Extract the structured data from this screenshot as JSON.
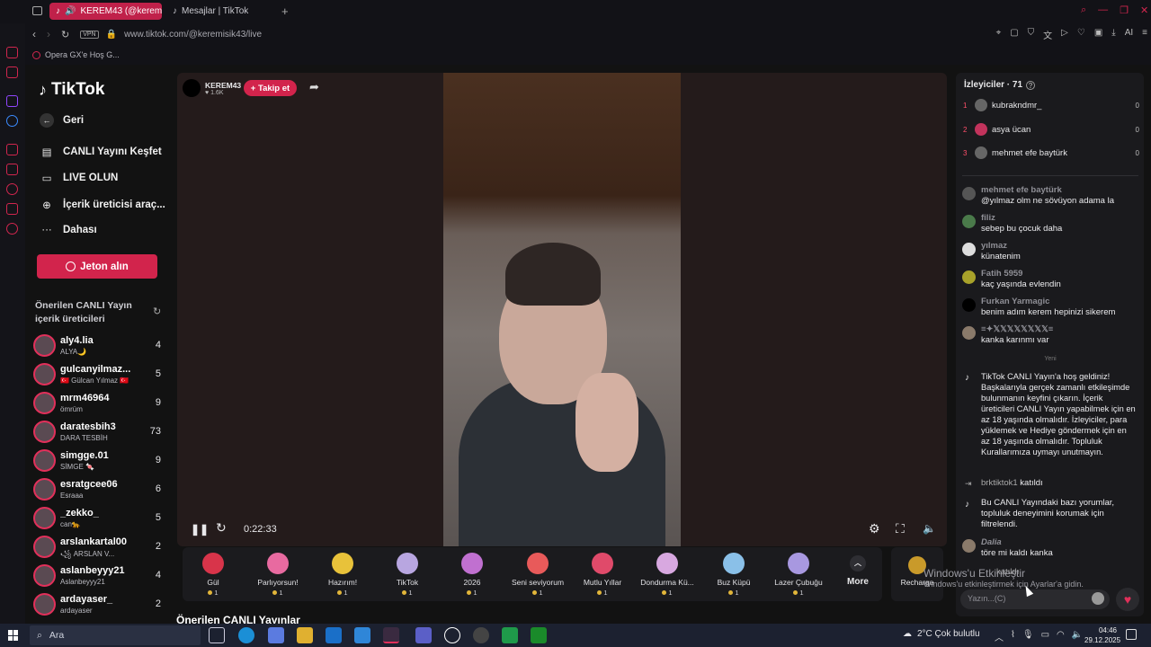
{
  "browser": {
    "tabs": [
      {
        "label": "KEREM43 (@keremsik"
      },
      {
        "label": "Mesajlar | TikTok"
      }
    ],
    "vpn": "VPN",
    "url": "www.tiktok.com/@keremisik43/live",
    "ai": "AI",
    "bookmark": "Opera GX'e Hoş G..."
  },
  "sidebar": {
    "logo": "TikTok",
    "nav": [
      {
        "icon": "←",
        "label": "Geri"
      },
      {
        "icon": "▤",
        "label": "CANLI Yayını Keşfet"
      },
      {
        "icon": "▭",
        "label": "LIVE OLUN"
      },
      {
        "icon": "⊕",
        "label": "İçerik üreticisi araç..."
      },
      {
        "icon": "···",
        "label": "Dahası"
      }
    ],
    "jeton": "Jeton alın",
    "suggested_title": "Önerilen CANLI Yayın içerik üreticileri",
    "suggested": [
      {
        "name": "aly4.lia",
        "sub": "ALYA🌙",
        "count": "4"
      },
      {
        "name": "gulcanyilmaz...",
        "sub": "🇹🇷 Gülcan Yılmaz 🇹🇷",
        "count": "5"
      },
      {
        "name": "mrm46964",
        "sub": "ömrüm",
        "count": "9"
      },
      {
        "name": "daratesbih3",
        "sub": "DARA TESBİH",
        "count": "73"
      },
      {
        "name": "simgge.01",
        "sub": "SİMGE 🍬",
        "count": "9"
      },
      {
        "name": "esratgcee06",
        "sub": "Esraaa",
        "count": "6"
      },
      {
        "name": "_zekko_",
        "sub": "can🐆",
        "count": "5"
      },
      {
        "name": "arslankartal00",
        "sub": "꧁ ARSLAN V...",
        "count": "2"
      },
      {
        "name": "aslanbeyyy21",
        "sub": "Aslanbeyyy21",
        "count": "4"
      },
      {
        "name": "ardayaser_",
        "sub": "ardayaser",
        "count": "2"
      }
    ]
  },
  "stream": {
    "host": "KEREM43",
    "likes": "1.6K",
    "follow": "+ Takip et",
    "time": "0:22:33"
  },
  "gifts": [
    {
      "name": "Gül",
      "price": "1",
      "color": "#d8344a"
    },
    {
      "name": "Parlıyorsun!",
      "price": "1",
      "color": "#e86aa0"
    },
    {
      "name": "Hazırım!",
      "price": "1",
      "color": "#e8c23a"
    },
    {
      "name": "TikTok",
      "price": "1",
      "color": "#b8a6e0"
    },
    {
      "name": "2026",
      "price": "1",
      "color": "#c070d0"
    },
    {
      "name": "Seni seviyorum",
      "price": "1",
      "color": "#e85a5a"
    },
    {
      "name": "Mutlu Yıllar",
      "price": "1",
      "color": "#e04a6a"
    },
    {
      "name": "Dondurma Kü...",
      "price": "1",
      "color": "#d8a8e0"
    },
    {
      "name": "Buz Küpü",
      "price": "1",
      "color": "#8ac0e8"
    },
    {
      "name": "Lazer Çubuğu",
      "price": "1",
      "color": "#a898e0"
    }
  ],
  "more": "More",
  "recharge": "Recharge",
  "chat": {
    "viewers_title": "İzleyiciler · 71",
    "viewers": [
      {
        "rank": "1",
        "name": "kubraknd​mr_",
        "count": "0"
      },
      {
        "rank": "2",
        "name": "asya ücan",
        "count": "0"
      },
      {
        "rank": "3",
        "name": "mehmet efe baytürk",
        "count": "0"
      }
    ],
    "messages": [
      {
        "user": "mehmet efe baytürk",
        "text": "@yılmaz olm ne sövüyon adama la"
      },
      {
        "user": "filiz",
        "text": "sebep bu çocuk daha"
      },
      {
        "user": "yılmaz",
        "text": "künatenim"
      },
      {
        "user": "Fatih 5959",
        "text": "kaç yaşında evlendin"
      },
      {
        "user": "Furkan Yarmagic",
        "text": "benim adım kerem hepinizi sikerem"
      },
      {
        "user": "≡✦𝕏𝕏𝕏𝕏𝕏𝕏𝕏𝕏≡",
        "text": "kanka karınmı var"
      }
    ],
    "new_label": "Yeni",
    "welcome": "TikTok CANLI Yayın'a hoş geldiniz! Başkalarıyla gerçek zamanlı etkileşimde bulunmanın keyfini çıkarın. İçerik üreticileri CANLI Yayın yapabilmek için en az 18 yaşında olmalıdır. İzleyiciler, para yüklemek ve Hediye göndermek için en az 18 yaşında olmalıdır. Topluluk Kurallarımıza uymayı unutmayın.",
    "joined_user": "brktiktok1",
    "joined_text": "katıldı",
    "filter_note": "Bu CANLI Yayındaki bazı yorumlar, topluluk deneyimini korumak için filtrelendi.",
    "last_user": "Dalia",
    "last_text": "töre mi kaldı kanka",
    "joined2": "katıldı",
    "input_placeholder": "Yazın...(C)"
  },
  "page_heading": "Önerilen CANLI Yayınlar",
  "windows_mark": {
    "title": "Windows'u Etkinleştir",
    "sub": "Windows'u etkinleştirmek için Ayarlar'a gidin."
  },
  "taskbar": {
    "search": "Ara",
    "weather": "2°C  Çok bulutlu",
    "time": "04:46",
    "date": "29.12.2025"
  }
}
